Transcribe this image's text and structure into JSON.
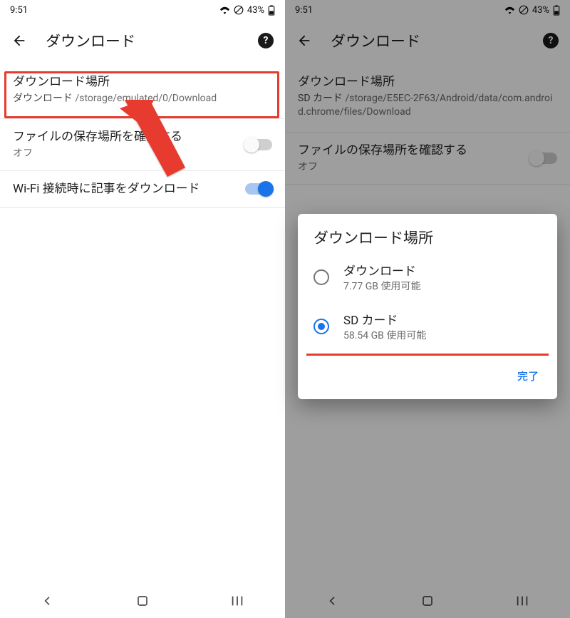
{
  "status": {
    "time": "9:51",
    "battery": "43%"
  },
  "toolbar": {
    "title": "ダウンロード"
  },
  "left": {
    "location": {
      "title": "ダウンロード場所",
      "prefix": "ダウンロード",
      "path": " /storage/emulated/0/Download"
    },
    "confirm": {
      "title": "ファイルの保存場所を確認する",
      "state": "オフ"
    },
    "wifi": {
      "title": "Wi-Fi 接続時に記事をダウンロード"
    }
  },
  "right": {
    "location": {
      "title": "ダウンロード場所",
      "prefix": "SD カード",
      "path": " /storage/E5EC-2F63/Android/data/com.android.chrome/files/Download"
    },
    "confirm": {
      "title": "ファイルの保存場所を確認する",
      "state": "オフ"
    }
  },
  "dialog": {
    "title": "ダウンロード場所",
    "options": [
      {
        "title": "ダウンロード",
        "sub": "7.77 GB 使用可能"
      },
      {
        "title": "SD カード",
        "sub": "58.54 GB 使用可能"
      }
    ],
    "done": "完了"
  }
}
